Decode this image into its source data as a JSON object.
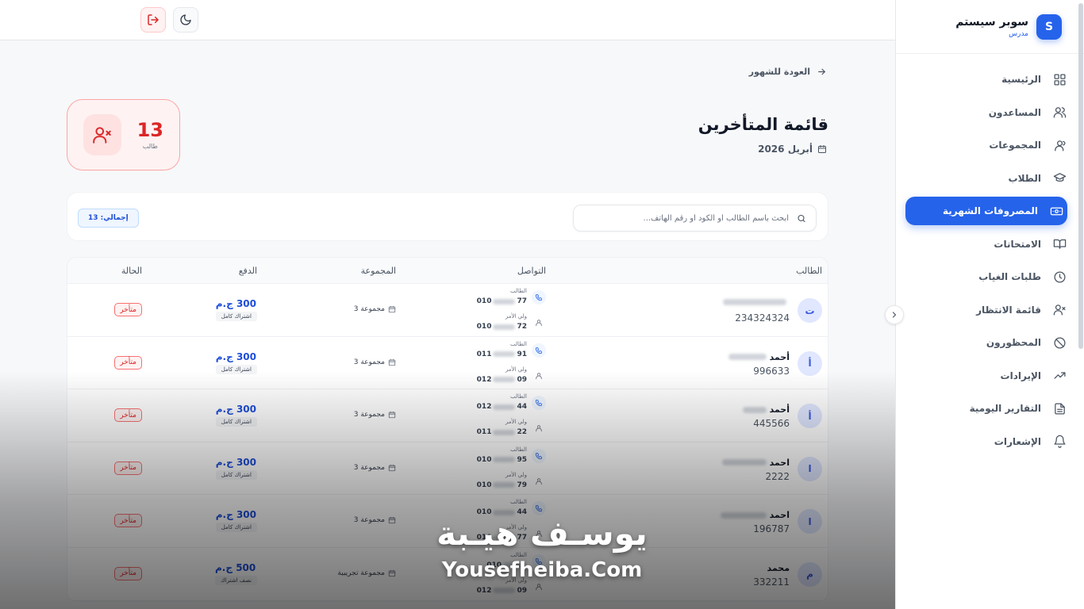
{
  "brand": {
    "name": "سوبر سيستم",
    "role": "مدرس",
    "logo_letter": "S"
  },
  "nav": [
    {
      "label": "الرئيسية",
      "icon": "grid-icon",
      "active": false
    },
    {
      "label": "المساعدون",
      "icon": "users-icon",
      "active": false
    },
    {
      "label": "المجموعات",
      "icon": "group-icon",
      "active": false
    },
    {
      "label": "الطلاب",
      "icon": "graduation-cap-icon",
      "active": false
    },
    {
      "label": "المصروفات الشهرية",
      "icon": "money-icon",
      "active": true
    },
    {
      "label": "الامتحانات",
      "icon": "book-icon",
      "active": false
    },
    {
      "label": "طلبات الغياب",
      "icon": "clock-icon",
      "active": false
    },
    {
      "label": "قائمة الانتظار",
      "icon": "user-x-icon",
      "active": false
    },
    {
      "label": "المحظورون",
      "icon": "ban-icon",
      "active": false
    },
    {
      "label": "الإيرادات",
      "icon": "trending-up-icon",
      "active": false
    },
    {
      "label": "التقارير اليومية",
      "icon": "document-icon",
      "active": false
    },
    {
      "label": "الإشعارات",
      "icon": "bell-icon",
      "active": false
    }
  ],
  "page": {
    "back_label": "العودة للشهور",
    "title": "قائمة المتأخرين",
    "month": "أبريل 2026"
  },
  "summary": {
    "count": "13",
    "label": "طالب"
  },
  "filters": {
    "search_placeholder": "ابحث باسم الطالب أو الكود أو رقم الهاتف...",
    "total_badge": "إجمالي: 13"
  },
  "table": {
    "headers": {
      "student": "الطالب",
      "contact": "التواصل",
      "group": "المجموعة",
      "payment": "الدفع",
      "status": "الحالة"
    },
    "contact_labels": {
      "student": "الطالب",
      "parent": "ولي الأمر"
    },
    "rows": [
      {
        "initial": "ت",
        "first_name": "",
        "code": "234324324",
        "student_phone_prefix": "010",
        "student_phone_suffix": "77",
        "parent_phone_prefix": "010",
        "parent_phone_suffix": "72",
        "group": "مجموعة 3",
        "amount": "300 ج.م",
        "pay_type": "اشتراك كامل",
        "status": "متأخر"
      },
      {
        "initial": "أ",
        "first_name": "أحمد",
        "code": "996633",
        "student_phone_prefix": "011",
        "student_phone_suffix": "91",
        "parent_phone_prefix": "012",
        "parent_phone_suffix": "09",
        "group": "مجموعة 3",
        "amount": "300 ج.م",
        "pay_type": "اشتراك كامل",
        "status": "متأخر"
      },
      {
        "initial": "أ",
        "first_name": "أحمد",
        "code": "445566",
        "student_phone_prefix": "012",
        "student_phone_suffix": "44",
        "parent_phone_prefix": "011",
        "parent_phone_suffix": "22",
        "group": "مجموعة 3",
        "amount": "300 ج.م",
        "pay_type": "اشتراك كامل",
        "status": "متأخر"
      },
      {
        "initial": "ا",
        "first_name": "احمد",
        "code": "2222",
        "student_phone_prefix": "010",
        "student_phone_suffix": "95",
        "parent_phone_prefix": "010",
        "parent_phone_suffix": "79",
        "group": "مجموعة 3",
        "amount": "300 ج.م",
        "pay_type": "اشتراك كامل",
        "status": "متأخر"
      },
      {
        "initial": "ا",
        "first_name": "احمد",
        "code": "196787",
        "student_phone_prefix": "010",
        "student_phone_suffix": "44",
        "parent_phone_prefix": "010",
        "parent_phone_suffix": "77",
        "group": "مجموعة 3",
        "amount": "300 ج.م",
        "pay_type": "اشتراك كامل",
        "status": "متأخر"
      },
      {
        "initial": "م",
        "first_name": "محمد",
        "code": "332211",
        "student_phone_prefix": "010",
        "student_phone_suffix": "",
        "parent_phone_prefix": "012",
        "parent_phone_suffix": "09",
        "group": "مجموعة تجريبية",
        "amount": "500 ج.م",
        "pay_type": "نصف اشتراك",
        "status": "متأخر"
      }
    ]
  },
  "watermark": {
    "arabic": "يوسـف هيـبة",
    "english": "Yousefheiba.Com"
  },
  "colors": {
    "primary": "#2563eb",
    "danger": "#dc2626",
    "background": "#f7f8fa"
  }
}
